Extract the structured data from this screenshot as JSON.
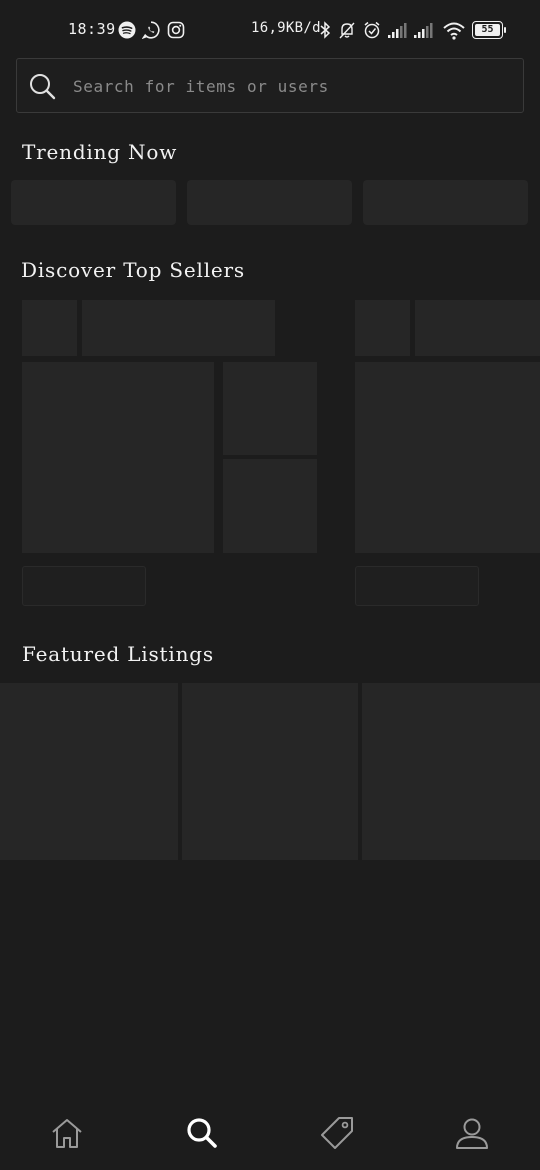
{
  "status_bar": {
    "time": "18:39",
    "app_icons": [
      "spotify-icon",
      "whatsapp-icon",
      "instagram-icon"
    ],
    "net_speed": "16,9KB/d",
    "system_icons": [
      "bluetooth-icon",
      "bell-muted-icon",
      "alarm-icon",
      "signal-icon",
      "signal-icon",
      "wifi-icon",
      "battery-icon"
    ],
    "battery_level": "55"
  },
  "search": {
    "placeholder": "Search for items or users",
    "value": ""
  },
  "sections": {
    "trending": "Trending Now",
    "top_sellers": "Discover Top Sellers",
    "featured": "Featured Listings"
  },
  "bottom_nav": {
    "items": [
      {
        "icon": "home-icon",
        "active": false
      },
      {
        "icon": "search-icon",
        "active": true
      },
      {
        "icon": "tag-icon",
        "active": false
      },
      {
        "icon": "profile-icon",
        "active": false
      }
    ]
  },
  "colors": {
    "background": "#1c1c1c",
    "skeleton": "#262626",
    "text": "#f2f2f2",
    "placeholder": "#8a8a8a",
    "nav_inactive": "#9a9a9a",
    "nav_active": "#ffffff"
  }
}
